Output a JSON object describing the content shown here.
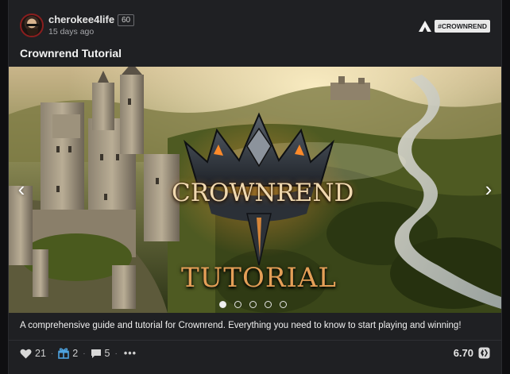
{
  "post": {
    "author": "cherokee4life",
    "reputation": "60",
    "timestamp": "15 days ago",
    "community_tag": "#CROWNREND",
    "title": "Crownrend Tutorial",
    "image_text": {
      "logo": "CROWNREND",
      "subtitle": "TUTORIAL"
    },
    "carousel": {
      "prev_symbol": "‹",
      "next_symbol": "›",
      "slides": 5,
      "active_slide": 1
    },
    "description": "A comprehensive guide and tutorial for Crownrend. Everything you need to know to start playing and winning!"
  },
  "footer": {
    "votes": "21",
    "gifts": "2",
    "comments": "5",
    "more": "•••",
    "payout": "6.70"
  },
  "colors": {
    "background": "#1f2023",
    "gift_icon": "#4ea3e0",
    "tag_bg": "#e9e9e9"
  },
  "icons": [
    "heart-icon",
    "gift-icon",
    "comment-icon",
    "more-icon",
    "hive-logo-icon",
    "community-icon"
  ]
}
